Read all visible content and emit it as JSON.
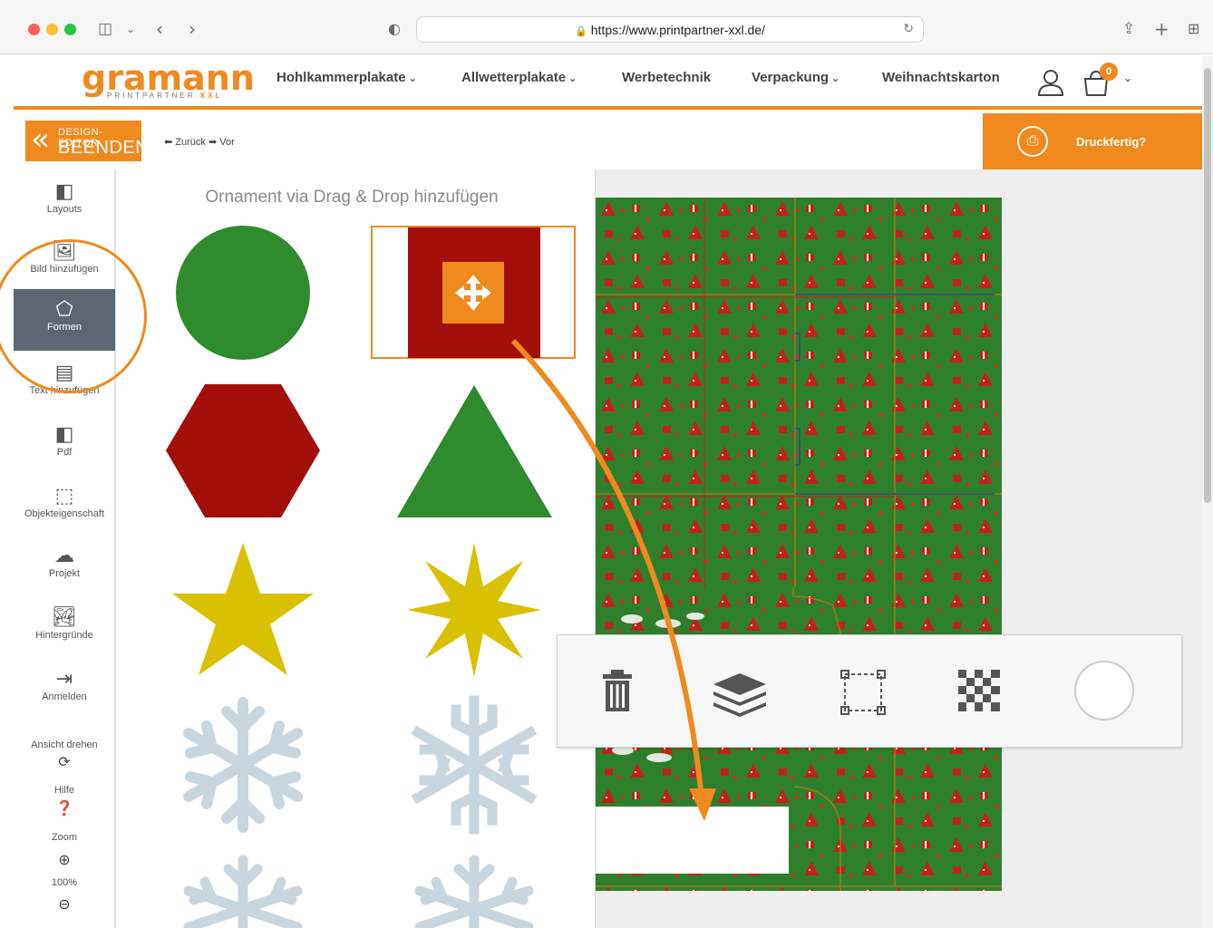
{
  "browser": {
    "url": "https://www.printpartner-xxl.de/"
  },
  "logo": {
    "word": "gramann",
    "tagline": "PRINTPARTNER",
    "tagline_accent": "XXL"
  },
  "nav": {
    "items": [
      {
        "label": "Hohlkammerplakate",
        "dropdown": true
      },
      {
        "label": "Allwetterplakate",
        "dropdown": true
      },
      {
        "label": "Werbetechnik",
        "dropdown": false
      },
      {
        "label": "Verpackung",
        "dropdown": true
      },
      {
        "label": "Weihnachtskarton",
        "dropdown": false
      }
    ],
    "cart_count": "0"
  },
  "editor": {
    "exit_line1": "DESIGN-EDITOR",
    "exit_line2": "BEENDEN",
    "undo_label": "Zurück",
    "redo_label": "Vor",
    "print_ready_label": "Druckfertig?"
  },
  "sidebar": {
    "items": [
      {
        "label": "Layouts",
        "icon": "layout-icon"
      },
      {
        "label": "Bild hinzufügen",
        "icon": "image-add-icon"
      },
      {
        "label": "Formen",
        "icon": "shapes-icon",
        "active": true
      },
      {
        "label": "Text hinzufügen",
        "icon": "text-add-icon"
      },
      {
        "label": "Pdf",
        "icon": "pdf-icon"
      },
      {
        "label": "Objekteigenschaft",
        "icon": "object-properties-icon"
      },
      {
        "label": "Projekt",
        "icon": "cloud-project-icon"
      },
      {
        "label": "Hintergründe",
        "icon": "backgrounds-icon"
      },
      {
        "label": "Anmelden",
        "icon": "login-icon"
      }
    ],
    "rotate_label": "Ansicht drehen",
    "help_label": "Hilfe",
    "zoom_label": "Zoom",
    "zoom_value": "100%"
  },
  "panel": {
    "title": "Ornament via Drag & Drop hinzufügen",
    "shapes": [
      {
        "name": "circle",
        "color": "#2e8b2e"
      },
      {
        "name": "square",
        "color": "#a30f0a",
        "selected": true
      },
      {
        "name": "hexagon",
        "color": "#a30f0a"
      },
      {
        "name": "triangle",
        "color": "#2e8b2e"
      },
      {
        "name": "star-5",
        "color": "#d9c000"
      },
      {
        "name": "star-8",
        "color": "#d9c000"
      },
      {
        "name": "snowflake-1",
        "color": "#c8d6e0"
      },
      {
        "name": "snowflake-2",
        "color": "#c8d6e0"
      },
      {
        "name": "snowflake-3",
        "color": "#c8d6e0"
      },
      {
        "name": "snowflake-4",
        "color": "#c8d6e0"
      }
    ]
  },
  "float_toolbar": {
    "tools": [
      "trash-icon",
      "layers-icon",
      "bounding-box-icon",
      "transparency-icon",
      "color-circle-icon"
    ]
  },
  "colors": {
    "accent": "#f08a1f",
    "pattern_green": "#2e7f2c",
    "pattern_red": "#c0221a",
    "sidebar_active": "#5b6874"
  }
}
